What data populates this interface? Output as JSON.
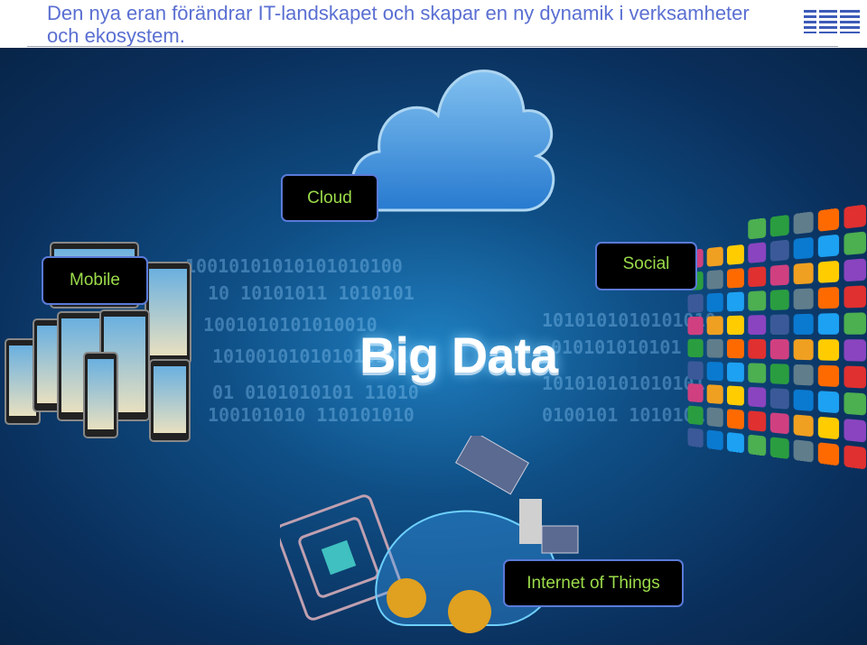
{
  "slide": {
    "title": "Den nya eran förändrar IT-landskapet och skapar en ny dynamik i verksamheter och ekosystem.",
    "logo": "IBM",
    "center_text": "Big Data",
    "labels": {
      "cloud": "Cloud",
      "mobile": "Mobile",
      "social": "Social",
      "iot": "Internet of Things"
    },
    "colors": {
      "title": "#5a6fd2",
      "label_text": "#9bdb4a",
      "label_border": "#5a7ad8",
      "background": "#0a2f5c"
    }
  }
}
